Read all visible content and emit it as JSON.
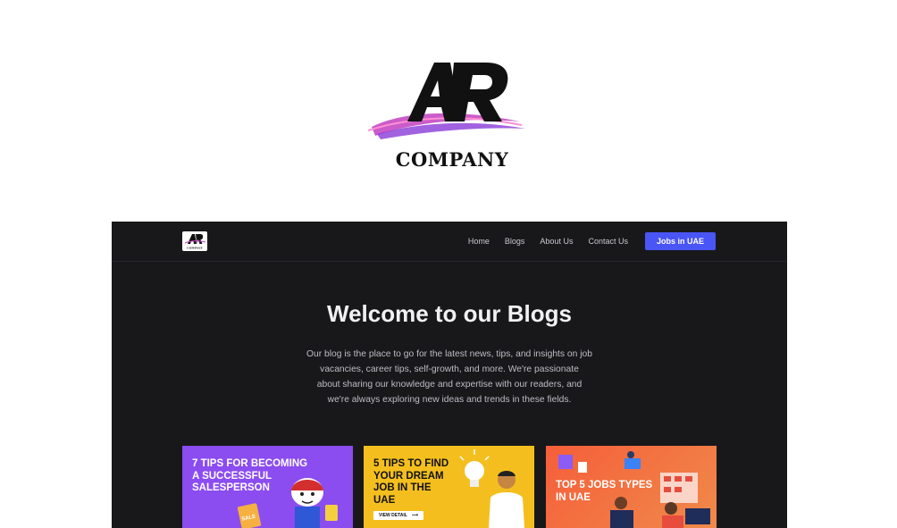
{
  "brand": {
    "logo_letters": "AR",
    "company": "COMPANY"
  },
  "nav": {
    "logo_letters": "AR",
    "logo_sub": "COMPANY",
    "items": [
      {
        "label": "Home"
      },
      {
        "label": "Blogs"
      },
      {
        "label": "About Us"
      },
      {
        "label": "Contact Us"
      }
    ],
    "cta_label": "Jobs in UAE"
  },
  "main": {
    "title": "Welcome to our Blogs",
    "intro_lines": [
      "Our blog is the place to go for the latest news, tips, and insights on job",
      "vacancies, career tips, self-growth, and more. We're passionate",
      "about sharing our knowledge and expertise with our readers, and",
      "we're always exploring new ideas and trends in these fields."
    ],
    "cards": [
      {
        "title_lines": [
          "7 TIPS FOR BECOMING",
          "A SUCCESSFUL",
          "SALESPERSON"
        ],
        "badge": "SALE"
      },
      {
        "title_lines": [
          "5 TIPS TO FIND",
          "YOUR DREAM",
          "JOB IN THE",
          "UAE"
        ],
        "button": "VIEW DETAIL"
      },
      {
        "title_lines": [
          "TOP 5 JOBS TYPES",
          "IN UAE"
        ]
      }
    ]
  },
  "colors": {
    "site_bg": "#18181b",
    "accent": "#4a55f5",
    "card1": "#8b4cf0",
    "card2": "#f4bf1e",
    "card3": "#f55e3a"
  },
  "icons": [
    "ar-logo-icon",
    "salesperson-illustration",
    "lightbulb-illustration",
    "thinking-man-illustration",
    "office-workers-illustration",
    "arrow-right-icon"
  ]
}
